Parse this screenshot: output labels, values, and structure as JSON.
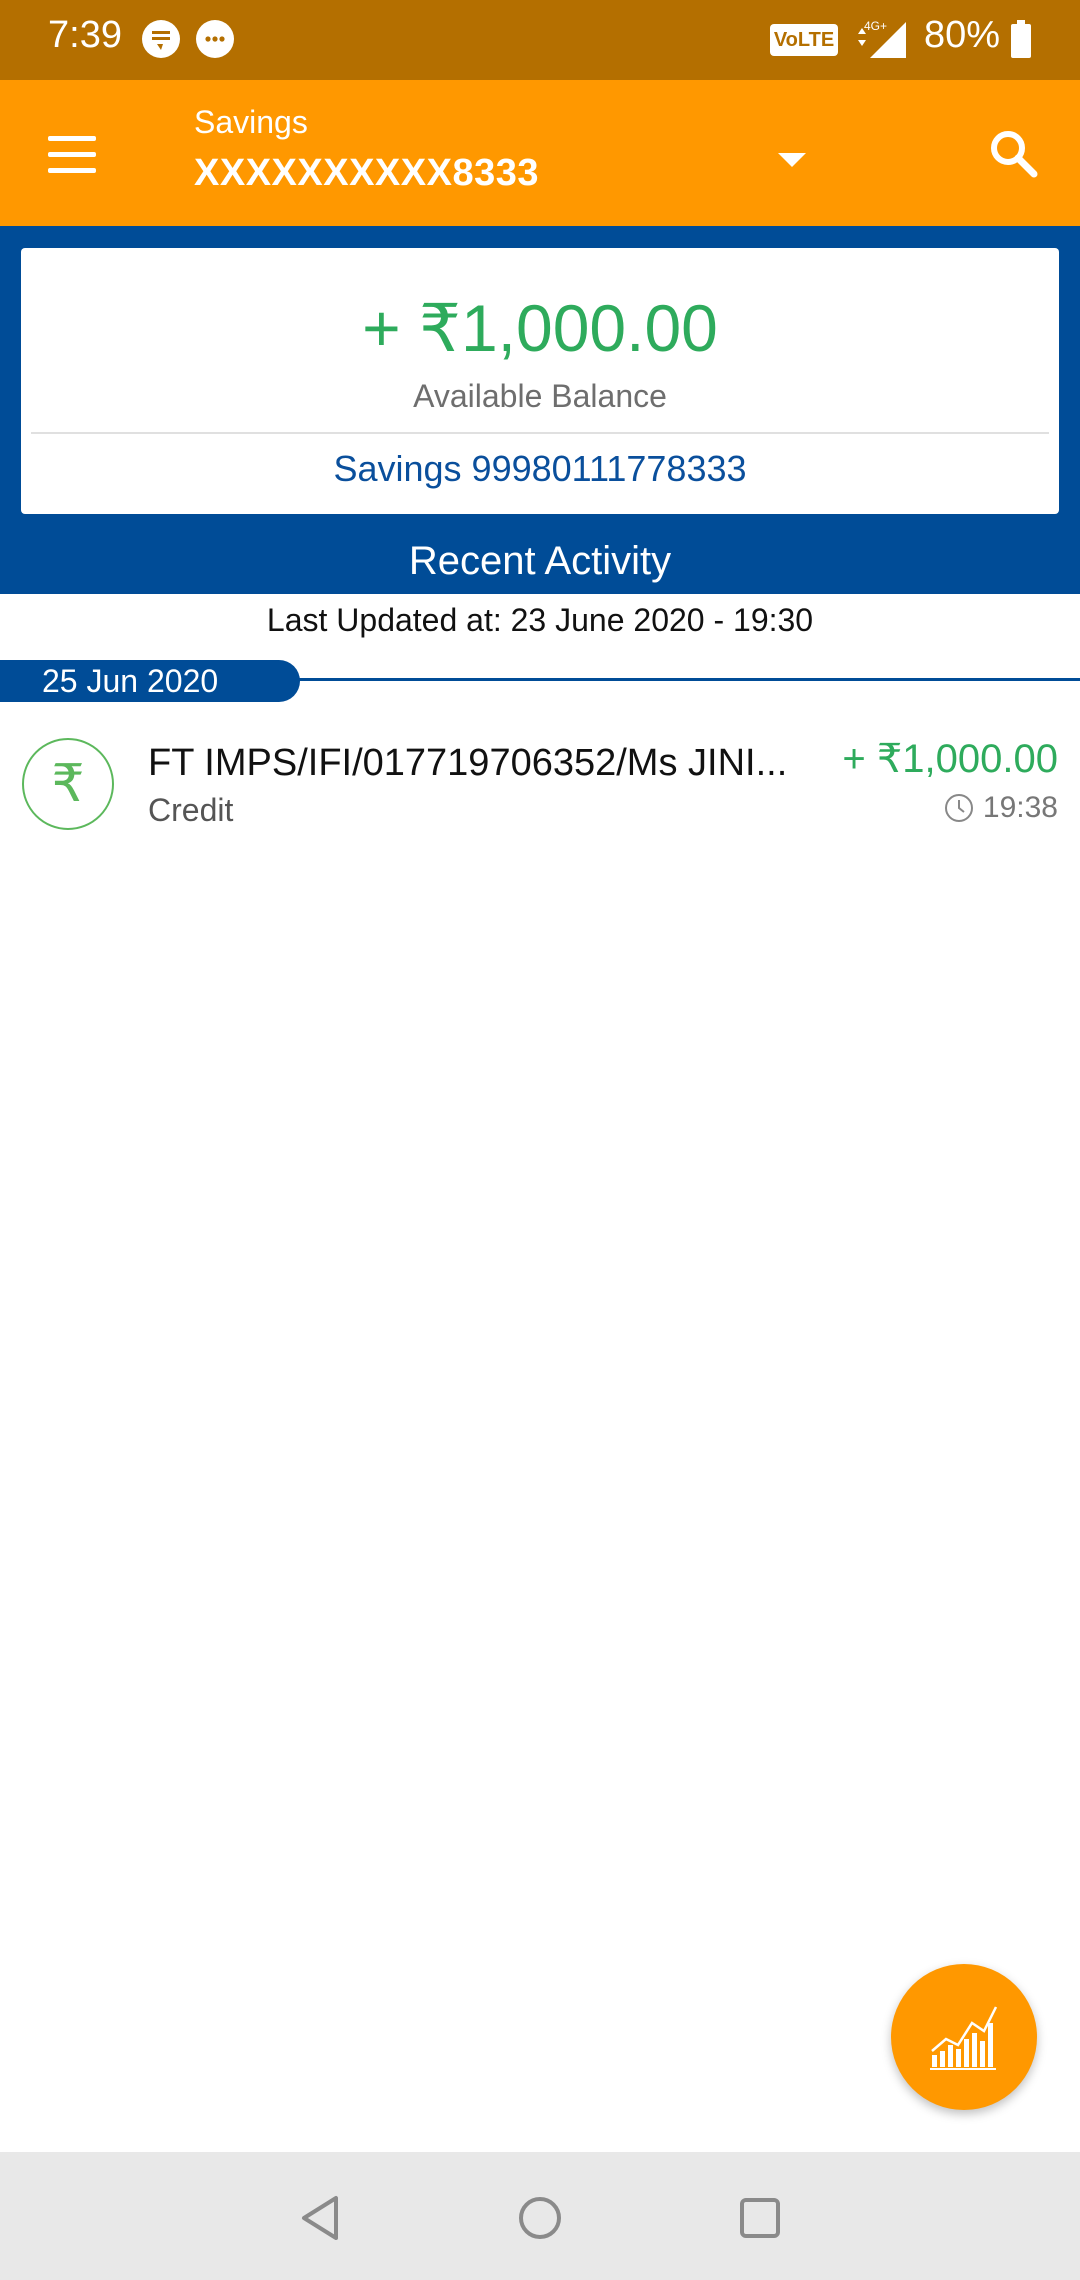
{
  "status_bar": {
    "time": "7:39",
    "network_badge": "VoLTE",
    "network_type": "4G+",
    "battery": "80%"
  },
  "app_bar": {
    "account_type": "Savings",
    "account_masked": "XXXXXXXXXX8333",
    "icons": [
      "menu-icon",
      "dropdown-caret-icon",
      "search-icon"
    ]
  },
  "balance": {
    "amount": "+ ₹1,000.00",
    "label": "Available Balance",
    "account_line": "Savings 99980111778333"
  },
  "recent_activity": {
    "title": "Recent Activity",
    "last_updated": "Last Updated at: 23 June 2020 - 19:30",
    "groups": [
      {
        "date": "25 Jun 2020",
        "transactions": [
          {
            "icon": "rupee-icon",
            "description": "FT IMPS/IFI/017719706352/Ms  JINI...",
            "type": "Credit",
            "amount": "+ ₹1,000.00",
            "time": "19:38"
          }
        ]
      }
    ]
  },
  "fab": {
    "icon": "analytics-chart-icon"
  },
  "nav_bar": {
    "icons": [
      "back-icon",
      "home-icon",
      "recents-icon"
    ]
  },
  "colors": {
    "status_bar": "#b46f00",
    "app_bar": "#ff9800",
    "brand_blue": "#004c97",
    "credit_green": "#2eab5c"
  }
}
